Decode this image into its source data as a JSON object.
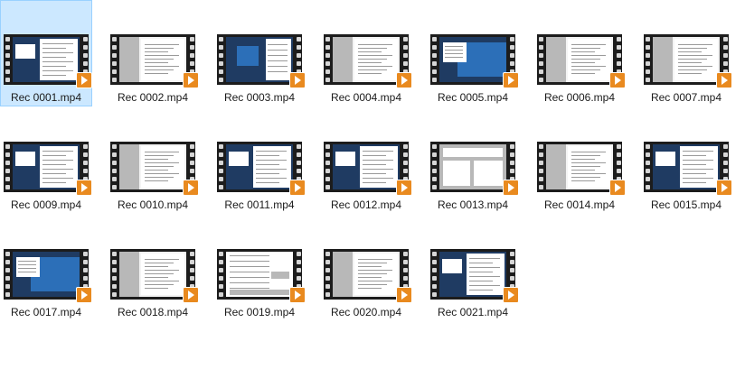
{
  "files": [
    {
      "name": "Rec 0001.mp4",
      "selected": true,
      "thumb": "desktop-doc"
    },
    {
      "name": "Rec 0002.mp4",
      "selected": false,
      "thumb": "document"
    },
    {
      "name": "Rec 0003.mp4",
      "selected": false,
      "thumb": "desktop-dark"
    },
    {
      "name": "Rec 0004.mp4",
      "selected": false,
      "thumb": "document"
    },
    {
      "name": "Rec 0005.mp4",
      "selected": false,
      "thumb": "desktop-blue"
    },
    {
      "name": "Rec 0006.mp4",
      "selected": false,
      "thumb": "document"
    },
    {
      "name": "Rec 0007.mp4",
      "selected": false,
      "thumb": "document"
    },
    {
      "name": "Rec 0009.mp4",
      "selected": false,
      "thumb": "desktop-doc"
    },
    {
      "name": "Rec 0010.mp4",
      "selected": false,
      "thumb": "document"
    },
    {
      "name": "Rec 0011.mp4",
      "selected": false,
      "thumb": "desktop-doc"
    },
    {
      "name": "Rec 0012.mp4",
      "selected": false,
      "thumb": "desktop-doc"
    },
    {
      "name": "Rec 0013.mp4",
      "selected": false,
      "thumb": "app-gray"
    },
    {
      "name": "Rec 0014.mp4",
      "selected": false,
      "thumb": "document"
    },
    {
      "name": "Rec 0015.mp4",
      "selected": false,
      "thumb": "desktop-doc"
    },
    {
      "name": "Rec 0017.mp4",
      "selected": false,
      "thumb": "desktop-blue"
    },
    {
      "name": "Rec 0018.mp4",
      "selected": false,
      "thumb": "document"
    },
    {
      "name": "Rec 0019.mp4",
      "selected": false,
      "thumb": "player"
    },
    {
      "name": "Rec 0020.mp4",
      "selected": false,
      "thumb": "document"
    },
    {
      "name": "Rec 0021.mp4",
      "selected": false,
      "thumb": "desktop-doc"
    }
  ],
  "icon": "video-file-icon",
  "colors": {
    "selection": "#cce8ff",
    "selection_border": "#99d1ff",
    "play_badge": "#e98a1f",
    "film": "#1c1c1c"
  }
}
